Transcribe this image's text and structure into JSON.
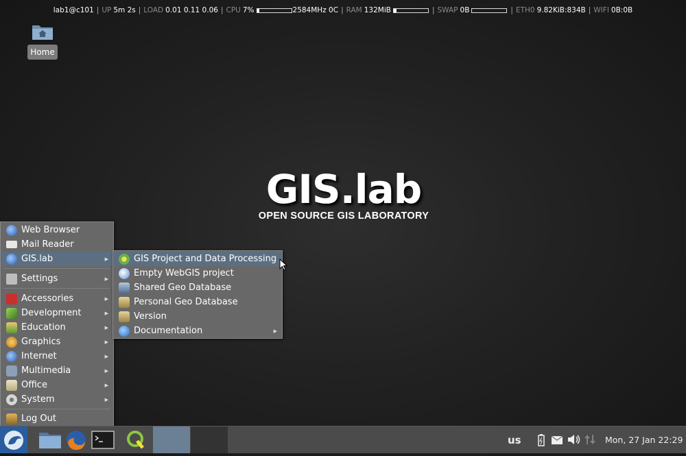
{
  "status": {
    "host": "lab1@c101",
    "up_label": "UP",
    "up": "5m 2s",
    "load_label": "LOAD",
    "load": "0.01 0.11 0.06",
    "cpu_label": "CPU",
    "cpu_pct": "7%",
    "cpu_fill": 0.07,
    "cpu_freq": "2584MHz 0C",
    "ram_label": "RAM",
    "ram": "132MiB",
    "ram_fill": 0.08,
    "swap_label": "SWAP",
    "swap": "0B",
    "swap_fill": 0.0,
    "eth_label": "ETH0",
    "eth": "9.82KiB:834B",
    "wifi_label": "WIFI",
    "wifi": "0B:0B"
  },
  "desktop": {
    "home_label": "Home"
  },
  "logo": {
    "title": "GIS.lab",
    "subtitle": "OPEN SOURCE GIS LABORATORY"
  },
  "main_menu": {
    "items": [
      {
        "label": "Web Browser",
        "icon": "globe-icon"
      },
      {
        "label": "Mail Reader",
        "icon": "mail-icon"
      },
      {
        "label": "GIS.lab",
        "icon": "globe-icon"
      },
      {
        "label": "Settings",
        "icon": "settings-icon"
      },
      {
        "label": "Accessories",
        "icon": "accessories-icon"
      },
      {
        "label": "Development",
        "icon": "development-icon"
      },
      {
        "label": "Education",
        "icon": "education-icon"
      },
      {
        "label": "Graphics",
        "icon": "graphics-icon"
      },
      {
        "label": "Internet",
        "icon": "globe-icon"
      },
      {
        "label": "Multimedia",
        "icon": "multimedia-icon"
      },
      {
        "label": "Office",
        "icon": "office-icon"
      },
      {
        "label": "System",
        "icon": "gear-icon"
      },
      {
        "label": "Log Out",
        "icon": "logout-icon"
      }
    ]
  },
  "gis_submenu": {
    "items": [
      {
        "label": "GIS Project and Data Processing",
        "icon": "qgis-icon"
      },
      {
        "label": "Empty WebGIS project",
        "icon": "webgis-icon"
      },
      {
        "label": "Shared Geo Database",
        "icon": "database-icon"
      },
      {
        "label": "Personal Geo Database",
        "icon": "briefcase-icon"
      },
      {
        "label": "Version",
        "icon": "briefcase-icon"
      },
      {
        "label": "Documentation",
        "icon": "help-icon"
      }
    ]
  },
  "taskbar": {
    "keyboard_layout": "us",
    "clock": "Mon, 27 Jan  22:29"
  }
}
